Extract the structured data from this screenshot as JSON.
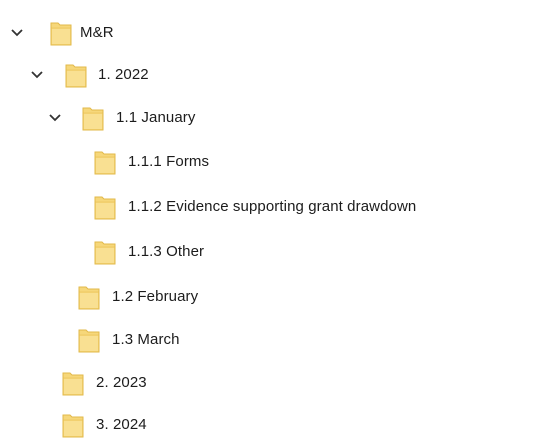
{
  "tree": {
    "items": [
      {
        "label": "M&R",
        "expanded": true
      },
      {
        "label": "1. 2022",
        "expanded": true
      },
      {
        "label": "1.1 January",
        "expanded": true
      },
      {
        "label": "1.1.1 Forms"
      },
      {
        "label": "1.1.2 Evidence supporting grant drawdown"
      },
      {
        "label": "1.1.3 Other"
      },
      {
        "label": "1.2 February"
      },
      {
        "label": "1.3 March"
      },
      {
        "label": "2. 2023"
      },
      {
        "label": "3. 2024"
      }
    ]
  },
  "colors": {
    "folder_fill": "#f6d77a",
    "folder_edge": "#e2b94a",
    "folder_light": "#fbe7a6",
    "chevron": "#333333"
  }
}
